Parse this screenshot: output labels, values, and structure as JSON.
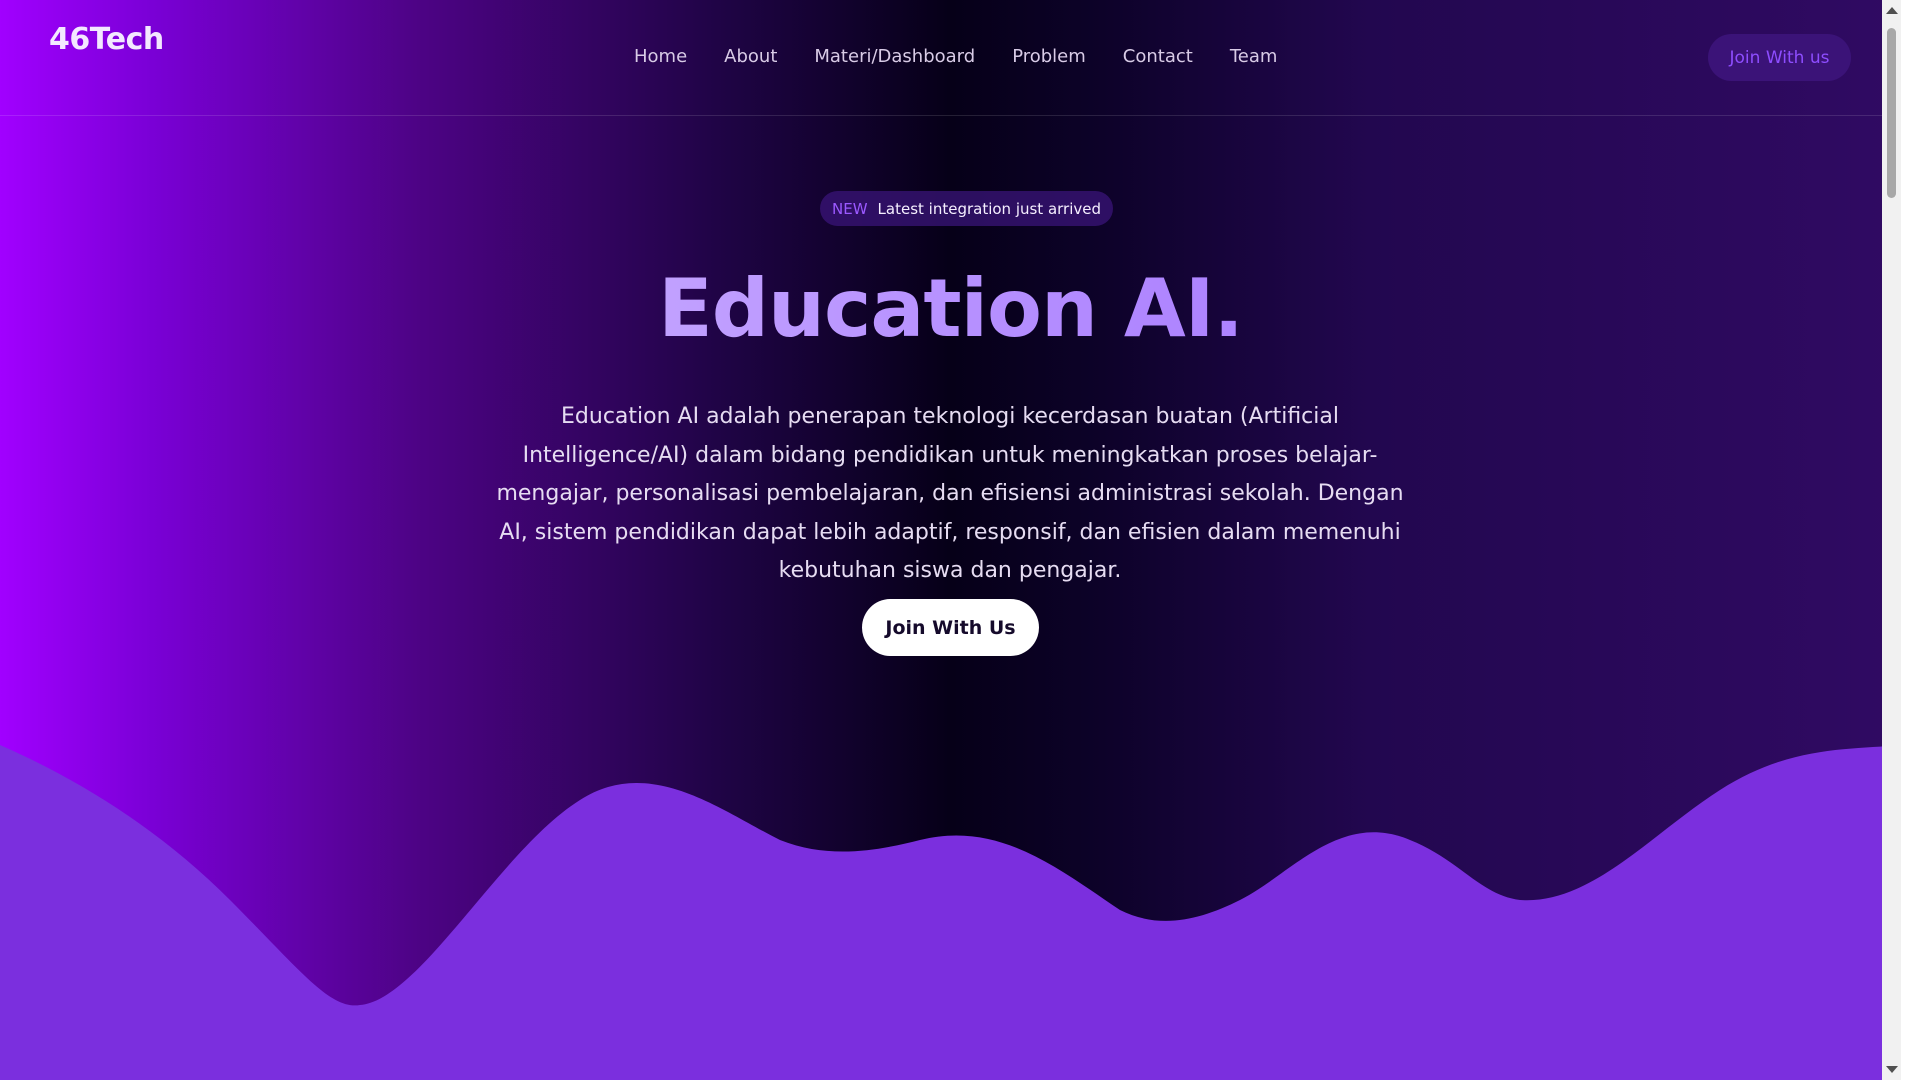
{
  "brand": {
    "logo": "46Tech"
  },
  "nav": {
    "links": [
      {
        "label": "Home"
      },
      {
        "label": "About"
      },
      {
        "label": "Materi/Dashboard"
      },
      {
        "label": "Problem"
      },
      {
        "label": "Contact"
      },
      {
        "label": "Team"
      }
    ],
    "cta_label": "Join With us"
  },
  "hero": {
    "badge_tag": "NEW",
    "badge_text": "Latest integration just arrived",
    "title": "Education AI.",
    "description": "Education AI adalah penerapan teknologi kecerdasan buatan (Artificial Intelligence/AI) dalam bidang pendidikan untuk meningkatkan proses belajar-mengajar, personalisasi pembelajaran, dan efisiensi administrasi sekolah. Dengan AI, sistem pendidikan dapat lebih adaptif, responsif, dan efisien dalam memenuhi kebutuhan siswa dan pengajar.",
    "cta_label": "Join With Us"
  },
  "colors": {
    "wave": "#7b2fde",
    "accent": "#9b59ff",
    "background_dark": "#060018",
    "background_left": "#a100ff"
  }
}
